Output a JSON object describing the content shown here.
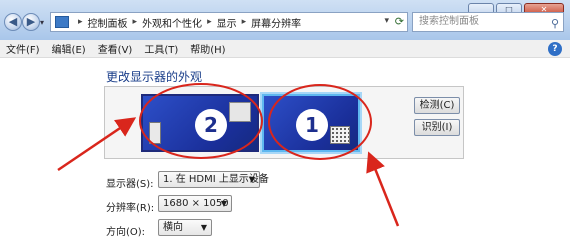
{
  "address_bar": {
    "crumbs": [
      "控制面板",
      "外观和个性化",
      "显示",
      "屏幕分辨率"
    ]
  },
  "search": {
    "placeholder": "搜索控制面板"
  },
  "menu": {
    "items": [
      "文件(F)",
      "编辑(E)",
      "查看(V)",
      "工具(T)",
      "帮助(H)"
    ]
  },
  "content": {
    "heading": "更改显示器的外观",
    "monitors": [
      {
        "number": "2",
        "selected": false
      },
      {
        "number": "1",
        "selected": true
      }
    ],
    "detect_button": "检测(C)",
    "identify_button": "识别(I)",
    "display_label": "显示器(S):",
    "display_value": "1. 在 HDMI 上显示设备",
    "resolution_label": "分辨率(R):",
    "resolution_value": "1680 × 1050",
    "orientation_label": "方向(O):",
    "orientation_value": "横向"
  },
  "colors": {
    "annotation_red": "#d9261c",
    "monitor_blue": "#1a2f9a",
    "heading_blue": "#1a3e8a"
  }
}
